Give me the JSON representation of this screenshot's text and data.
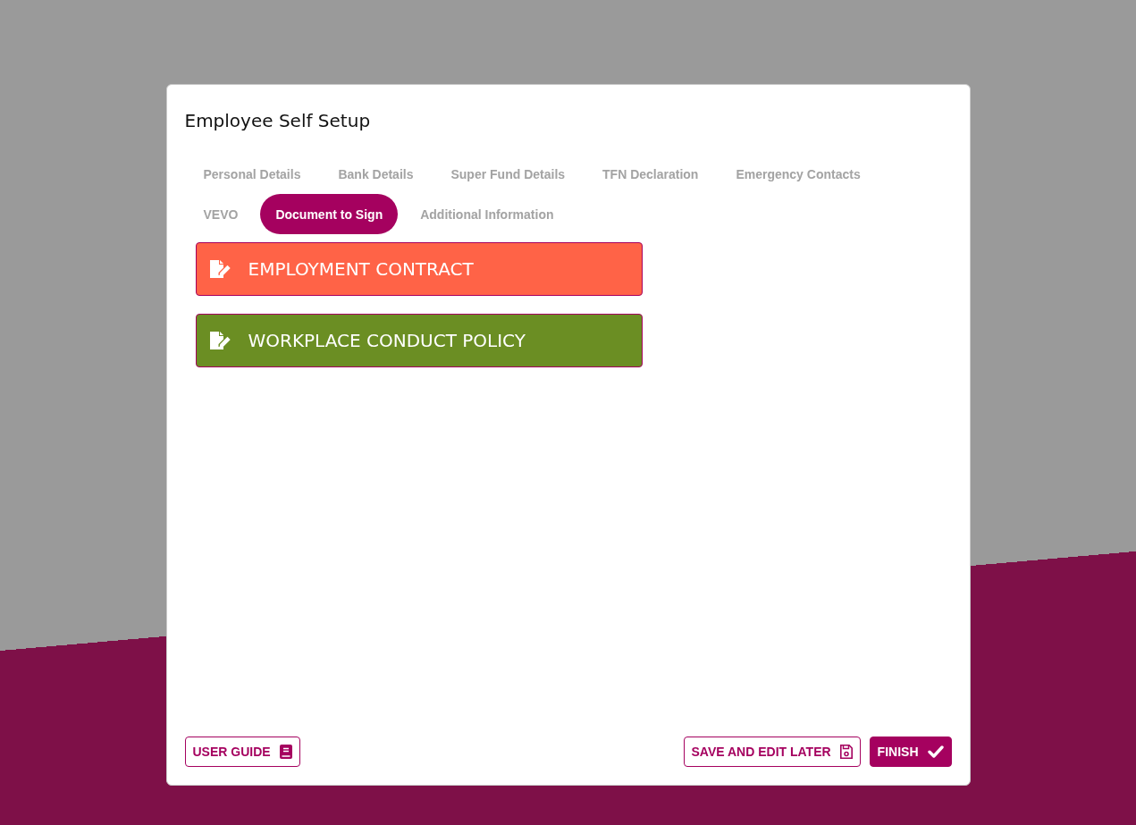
{
  "dialog": {
    "title": "Employee Self Setup"
  },
  "tabs": [
    {
      "label": "Personal Details",
      "selected": false
    },
    {
      "label": "Bank Details",
      "selected": false
    },
    {
      "label": "Super Fund Details",
      "selected": false
    },
    {
      "label": "TFN Declaration",
      "selected": false
    },
    {
      "label": "Emergency Contacts",
      "selected": false
    },
    {
      "label": "VEVO",
      "selected": false
    },
    {
      "label": "Document to Sign",
      "selected": true
    },
    {
      "label": "Additional Information",
      "selected": false
    }
  ],
  "documents": [
    {
      "label": "EMPLOYMENT CONTRACT",
      "color": "#ff6347"
    },
    {
      "label": "WORKPLACE CONDUCT POLICY",
      "color": "#6b8e23"
    }
  ],
  "footer": {
    "user_guide": {
      "label": "USER GUIDE"
    },
    "save_later": {
      "label": "SAVE AND EDIT LATER"
    },
    "finish": {
      "label": "FINISH"
    }
  }
}
